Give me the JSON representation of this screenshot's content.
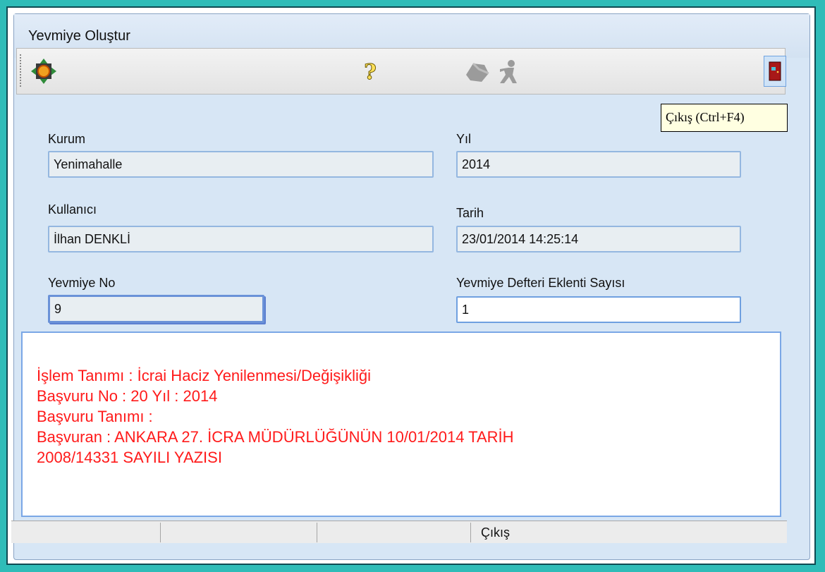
{
  "window": {
    "title": "Yevmiye Oluştur"
  },
  "toolbar": {
    "icons": [
      "navigate-icon",
      "help-icon",
      "tool-disabled-icon",
      "run-disabled-icon",
      "exit-door-icon"
    ]
  },
  "tooltip": {
    "text": "Çıkış (Ctrl+F4)"
  },
  "form": {
    "kurum_label": "Kurum",
    "kurum_value": "Yenimahalle",
    "yil_label": "Yıl",
    "yil_value": "2014",
    "kullanici_label": "Kullanıcı",
    "kullanici_value": "İlhan DENKLİ",
    "tarih_label": "Tarih",
    "tarih_value": "23/01/2014 14:25:14",
    "yevmiye_no_label": "Yevmiye No",
    "yevmiye_no_value": "9",
    "eklenti_label": "Yevmiye Defteri Eklenti Sayısı",
    "eklenti_value": "1"
  },
  "info": {
    "lines": [
      "İşlem Tanımı : İcrai Haciz Yenilenmesi/Değişikliği",
      "Başvuru No : 20   Yıl : 2014",
      "Başvuru Tanımı :",
      "Başvuran : ANKARA 27. İCRA MÜDÜRLÜĞÜNÜN 10/01/2014 TARİH",
      "2008/14331 SAYILI YAZISI"
    ],
    "color": "#ff1a1a"
  },
  "statusbar": {
    "exit_label": "Çıkış"
  }
}
